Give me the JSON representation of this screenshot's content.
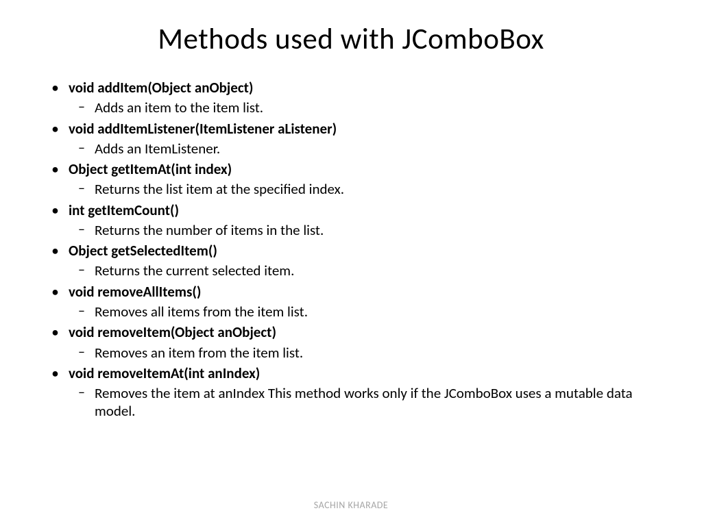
{
  "title": "Methods used with JComboBox",
  "methods": [
    {
      "sig": "void addItem(Object anObject)",
      "desc": "Adds an item to the item list."
    },
    {
      "sig": "void addItemListener(ItemListener aListener)",
      "desc": "Adds an ItemListener."
    },
    {
      "sig": "Object getItemAt(int index)",
      "desc": "Returns the list item at the specified index."
    },
    {
      "sig": "int getItemCount()",
      "desc": "Returns the number of items in the list."
    },
    {
      "sig": "Object getSelectedItem()",
      "desc": "Returns the current selected item."
    },
    {
      "sig": "void removeAllItems()",
      "desc": "Removes all items from the item list."
    },
    {
      "sig": "void removeItem(Object anObject)",
      "desc": "Removes an item from the item list."
    },
    {
      "sig": "void removeItemAt(int anIndex)",
      "desc": "Removes the item at anIndex This method works only if the JComboBox uses a mutable data model."
    }
  ],
  "footer": "SACHIN KHARADE"
}
